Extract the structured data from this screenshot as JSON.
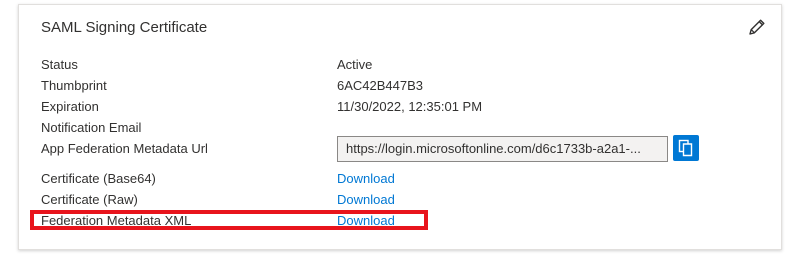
{
  "card": {
    "title": "SAML Signing Certificate",
    "edit_icon": "pencil-icon"
  },
  "rows": {
    "status": {
      "label": "Status",
      "value": "Active"
    },
    "thumbprint": {
      "label": "Thumbprint",
      "value": "6AC42B447B3"
    },
    "expiration": {
      "label": "Expiration",
      "value": "11/30/2022, 12:35:01 PM"
    },
    "notification_email": {
      "label": "Notification Email",
      "value": ""
    },
    "metadata_url": {
      "label": "App Federation Metadata Url",
      "value": "https://login.microsoftonline.com/d6c1733b-a2a1-...",
      "copy_icon": "copy-icon"
    },
    "cert_base64": {
      "label": "Certificate (Base64)",
      "link": "Download"
    },
    "cert_raw": {
      "label": "Certificate (Raw)",
      "link": "Download"
    },
    "federation_xml": {
      "label": "Federation Metadata XML",
      "link": "Download"
    }
  },
  "colors": {
    "link": "#0078d4",
    "highlight": "#e8141c",
    "copy_button": "#0078d4"
  }
}
